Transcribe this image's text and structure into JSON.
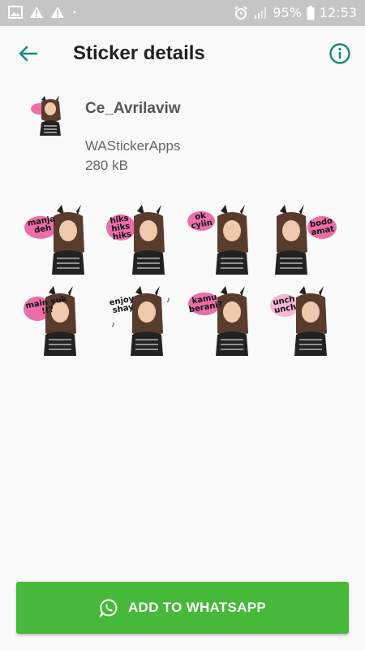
{
  "status_bar": {
    "battery": "95%",
    "time": "12:53",
    "left_icons": [
      "image-icon",
      "warning-icon",
      "warning-icon",
      "dot"
    ],
    "right_icons": [
      "alarm-icon",
      "signal-icon",
      "battery-icon"
    ]
  },
  "app_bar": {
    "title": "Sticker details",
    "back_icon": "arrow-back-icon",
    "info_icon": "info-icon",
    "accent_color": "#1a8a7e"
  },
  "pack": {
    "name": "Ce_Avrilaviw",
    "publisher": "WAStickerApps",
    "size": "280 kB",
    "thumb_caption": "unch unch"
  },
  "stickers": [
    {
      "caption": "manja deh"
    },
    {
      "caption": "hiks hiks hiks"
    },
    {
      "caption": "ok cyiin"
    },
    {
      "caption": "bodo amat"
    },
    {
      "caption": "main yuk !!?"
    },
    {
      "caption": "enjoy shay"
    },
    {
      "caption": "kamu berani?"
    },
    {
      "caption": "unch unch"
    }
  ],
  "add_button": {
    "label": "ADD TO WHATSAPP",
    "icon": "whatsapp-icon",
    "color": "#46b83a"
  }
}
